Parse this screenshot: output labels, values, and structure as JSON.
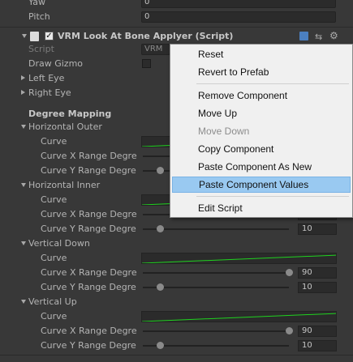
{
  "top_fields": [
    {
      "label": "Yaw",
      "value": "0"
    },
    {
      "label": "Pitch",
      "value": "0"
    }
  ],
  "component": {
    "title": "VRM Look At Bone Applyer (Script)",
    "enabled": true,
    "script_label": "Script",
    "script_value": "VRM",
    "draw_gizmo_label": "Draw Gizmo",
    "left_eye_label": "Left Eye",
    "right_eye_label": "Right Eye",
    "degree_mapping_label": "Degree Mapping"
  },
  "mappings": [
    {
      "label": "Horizontal Outer",
      "curve": "Curve",
      "x_label": "Curve X Range Degre",
      "y_label": "Curve Y Range Degre",
      "x_value": "",
      "y_value": ""
    },
    {
      "label": "Horizontal Inner",
      "curve": "Curve",
      "x_label": "Curve X Range Degre",
      "y_label": "Curve Y Range Degre",
      "x_value": "",
      "y_value": "10"
    },
    {
      "label": "Vertical Down",
      "curve": "Curve",
      "x_label": "Curve X Range Degre",
      "y_label": "Curve Y Range Degre",
      "x_value": "90",
      "y_value": "10"
    },
    {
      "label": "Vertical Up",
      "curve": "Curve",
      "x_label": "Curve X Range Degre",
      "y_label": "Curve Y Range Degre",
      "x_value": "90",
      "y_value": "10"
    }
  ],
  "menu": {
    "items": [
      "Reset",
      "Revert to Prefab",
      "Remove Component",
      "Move Up",
      "Move Down",
      "Copy Component",
      "Paste Component As New",
      "Paste Component Values",
      "Edit Script"
    ],
    "disabled": "Move Down",
    "highlighted": "Paste Component Values"
  },
  "colors": {
    "curve": "#1fd21f",
    "highlight": "#99c9f1",
    "panel": "#383838"
  }
}
